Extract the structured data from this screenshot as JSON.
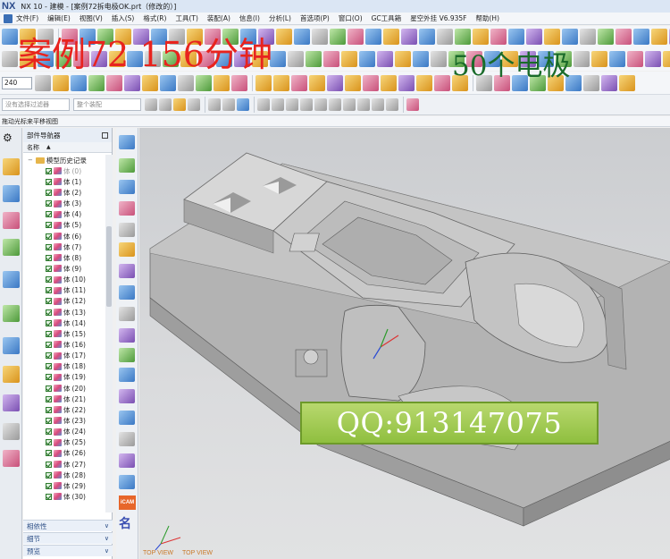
{
  "titlebar": {
    "logo": "NX",
    "title": "NX 10 - 建模 - [案例72拆电极OK.prt（修改的）]"
  },
  "menubar": {
    "items": [
      "文件(F)",
      "编辑(E)",
      "视图(V)",
      "插入(S)",
      "格式(R)",
      "工具(T)",
      "装配(A)",
      "信息(I)",
      "分析(L)",
      "首选项(P)",
      "窗口(O)",
      "GC工具箱",
      "星空外挂 V6.935F",
      "帮助(H)"
    ]
  },
  "overlay": {
    "red_text": "案例72  156分钟",
    "green_text": "50个电极"
  },
  "toolbar": {
    "zoom_value": "240",
    "selection_filter_placeholder": "没有选择过滤器",
    "assembly_scope_placeholder": "整个装配"
  },
  "statusline": {
    "text": "拖动光标来平移视图"
  },
  "navigator": {
    "title": "部件导航器",
    "column_name": "名称",
    "root_label": "模型历史记录",
    "body_label": "体",
    "bodies": [
      "(0)",
      "(1)",
      "(2)",
      "(3)",
      "(4)",
      "(5)",
      "(6)",
      "(7)",
      "(8)",
      "(9)",
      "(10)",
      "(11)",
      "(12)",
      "(13)",
      "(14)",
      "(15)",
      "(16)",
      "(17)",
      "(18)",
      "(19)",
      "(20)",
      "(21)",
      "(22)",
      "(23)",
      "(24)",
      "(25)",
      "(26)",
      "(27)",
      "(28)",
      "(29)",
      "(30)"
    ],
    "panels": {
      "dependency": "相依性",
      "details": "细节",
      "preview": "预览"
    }
  },
  "vstrip": {
    "icam_label": "iCAM",
    "ming_label": "名"
  },
  "viewport": {
    "qq_text": "QQ:913147075",
    "view_label_left": "TOP VIEW",
    "view_label_right": "TOP VIEW"
  },
  "colors": {
    "overlay_red": "#e8231e",
    "overlay_green": "#1a6b2a",
    "qq_box": "#9cc94a",
    "model_gray": "#bdbdbd"
  }
}
